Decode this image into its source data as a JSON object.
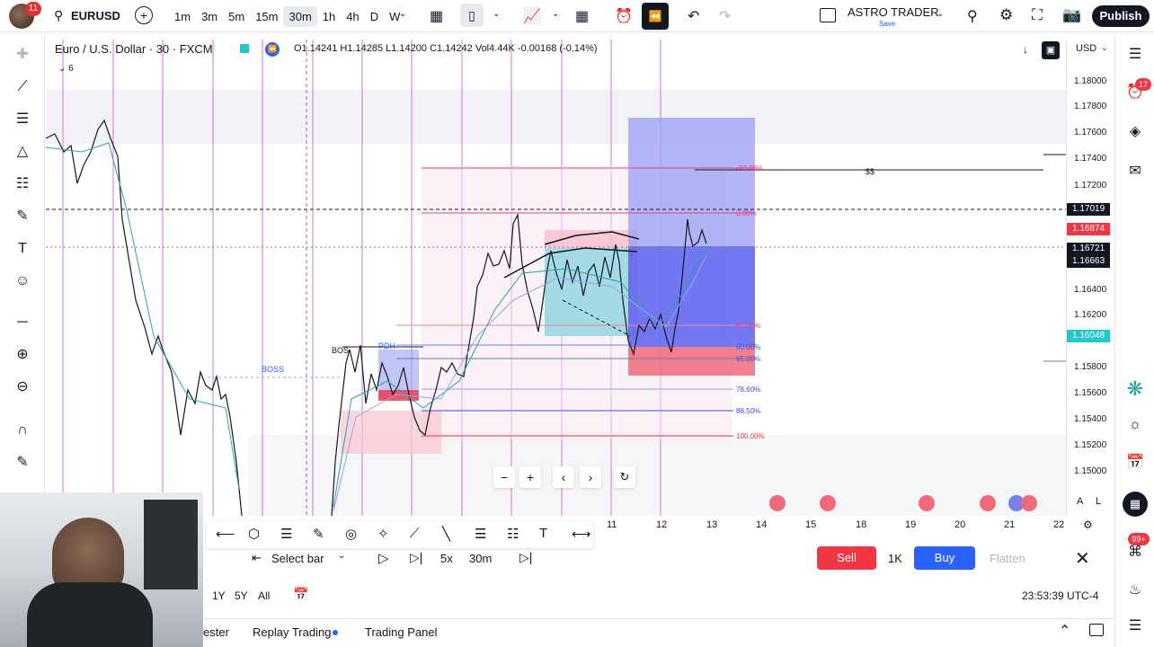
{
  "topbar": {
    "avatar_badge": "11",
    "symbol": "EURUSD",
    "intervals": [
      "1m",
      "3m",
      "5m",
      "15m",
      "30m",
      "1h",
      "4h",
      "D",
      "W"
    ],
    "active_interval": "30m",
    "layout_name": "ASTRO TRADER",
    "layout_status": "Save",
    "publish_label": "Publish"
  },
  "legend": {
    "title": "Euro / U.S. Dollar · 30 · FXCM",
    "ohlc": "O1.14241 H1.14285 L1.14200 C1.14242 Vol4.44K -0.00168 (-0.14%)",
    "indicator_count": "6"
  },
  "price_scale": {
    "currency": "USD",
    "labels": [
      "1.18000",
      "1.17800",
      "1.17600",
      "1.17400",
      "1.17200",
      "1.16400",
      "1.16200",
      "1.15800",
      "1.15600",
      "1.15400",
      "1.15200",
      "1.15000"
    ],
    "tags": [
      {
        "text": "1.17019",
        "color": "#131722"
      },
      {
        "text": "1.16874",
        "color": "#f23645"
      },
      {
        "text": "1.16721",
        "color": "#131722"
      },
      {
        "text": "1.16663",
        "color": "#131722"
      },
      {
        "text": "1.16048",
        "color": "#22c7c7"
      }
    ],
    "scale_modes": [
      "A",
      "L"
    ]
  },
  "chart": {
    "annotations": [
      "BOSS",
      "BOS",
      "PDH",
      "$$"
    ],
    "fib_levels": [
      "-20.00%",
      "0.00%",
      "50.00%",
      "60.00%",
      "65.00%",
      "78.60%",
      "88.50%",
      "100.00%"
    ]
  },
  "timebar": {
    "ticks": [
      "11",
      "12",
      "13",
      "14",
      "15",
      "18",
      "19",
      "20",
      "21",
      "22"
    ]
  },
  "replay": {
    "select_bar": "Select bar",
    "speed": "5x",
    "interval": "30m",
    "sell": "Sell",
    "qty": "1K",
    "buy": "Buy",
    "flatten": "Flatten"
  },
  "bottombar": {
    "ranges": [
      "1Y",
      "5Y",
      "All"
    ],
    "clock": "23:53:39 UTC-4"
  },
  "footer": {
    "tabs": [
      "ester",
      "Replay Trading",
      "Trading Panel"
    ]
  },
  "right_toolbar": {
    "alerts_badge": "17",
    "notif_badge": "99+"
  }
}
